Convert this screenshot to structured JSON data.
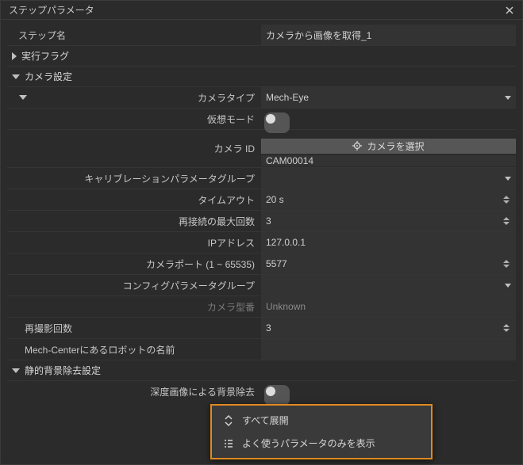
{
  "titlebar": {
    "title": "ステップパラメータ"
  },
  "step_name": {
    "label": "ステップ名",
    "value": "カメラから画像を取得_1"
  },
  "exec_flag": {
    "label": "実行フラグ"
  },
  "camera_settings": {
    "label": "カメラ設定",
    "camera_type": {
      "label": "カメラタイプ",
      "value": "Mech-Eye"
    },
    "virtual_mode": {
      "label": "仮想モード"
    },
    "camera_id": {
      "label": "カメラ ID",
      "button": "カメラを選択",
      "value": "CAM00014"
    },
    "calib_group": {
      "label": "キャリブレーションパラメータグループ",
      "value": ""
    },
    "timeout": {
      "label": "タイムアウト",
      "value": "20 s"
    },
    "reconnect_max": {
      "label": "再接続の最大回数",
      "value": "3"
    },
    "ip": {
      "label": "IPアドレス",
      "value": "127.0.0.1"
    },
    "port": {
      "label": "カメラポート (1 ~ 65535)",
      "value": "5577"
    },
    "config_group": {
      "label": "コンフィグパラメータグループ",
      "value": ""
    },
    "model": {
      "label": "カメラ型番",
      "value": "Unknown"
    }
  },
  "reshoot": {
    "label": "再撮影回数",
    "value": "3"
  },
  "robot_name": {
    "label": "Mech-Centerにあるロボットの名前",
    "value": ""
  },
  "static_bg": {
    "label": "静的背景除去設定",
    "depth_removal": {
      "label": "深度画像による背景除去"
    }
  },
  "context_menu": {
    "expand_all": "すべて展開",
    "show_common": "よく使うパラメータのみを表示"
  }
}
